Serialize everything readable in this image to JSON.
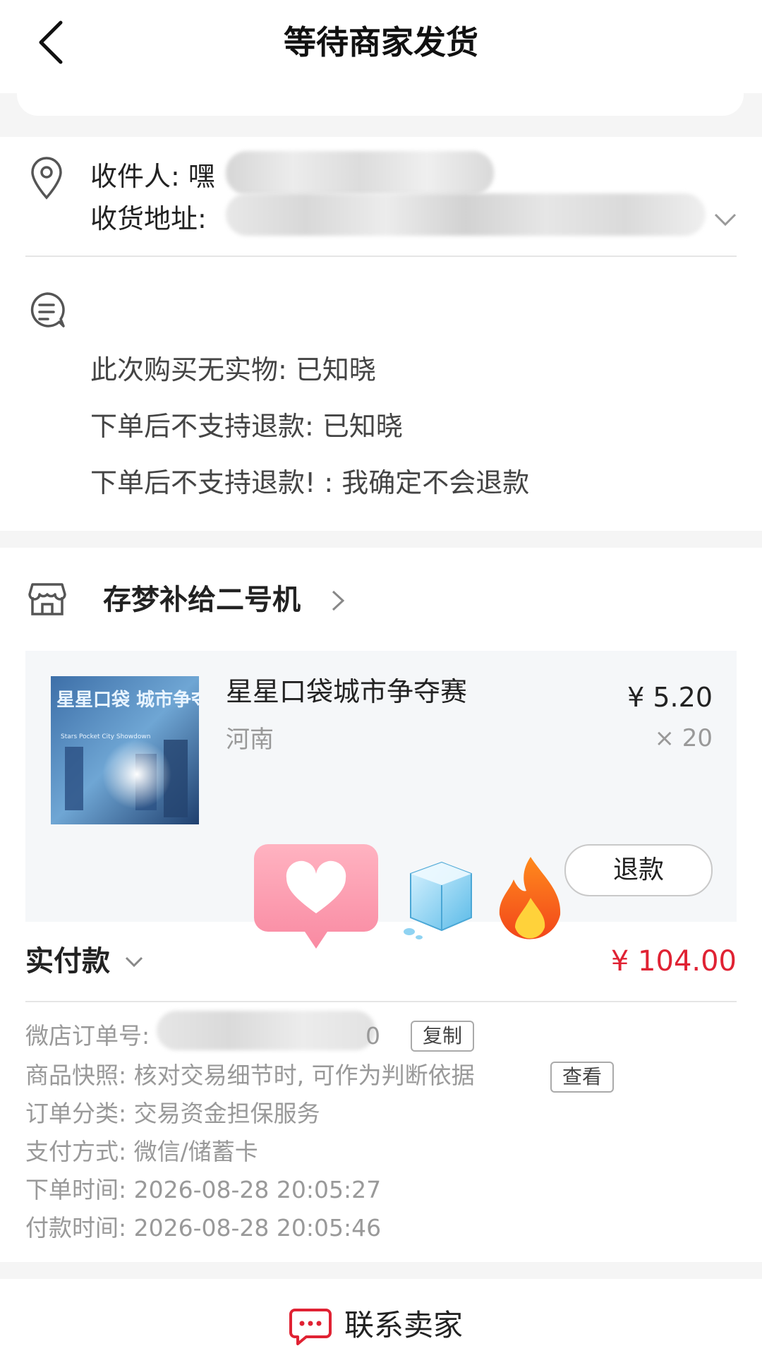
{
  "header": {
    "title": "等待商家发货"
  },
  "address": {
    "recipient_label": "收件人: 嘿",
    "address_label": "收货地址:"
  },
  "notes": [
    "此次购买无实物: 已知晓",
    "下单后不支持退款: 已知晓",
    "下单后不支持退款! : 我确定不会退款"
  ],
  "shop": {
    "name": "存梦补给二号机"
  },
  "product": {
    "name": "星星口袋城市争夺赛",
    "spec": "河南",
    "price": "¥ 5.20",
    "qty": "× 20",
    "image_title": "星星口袋 城市争夺赛",
    "image_subtitle": "Stars Pocket City Showdown",
    "refund_label": "退款"
  },
  "payment": {
    "label": "实付款",
    "amount": "¥ 104.00"
  },
  "order_info": {
    "order_no_label": "微店订单号:",
    "order_no_tail": "0",
    "copy_label": "复制",
    "snapshot": "商品快照: 核对交易细节时, 可作为判断依据",
    "view_label": "查看",
    "category": "订单分类:  交易资金担保服务",
    "pay_method": "支付方式:  微信/储蓄卡",
    "order_time": "下单时间:  2026-08-28 20:05:27",
    "pay_time": "付款时间:  2026-08-28 20:05:46"
  },
  "bottom": {
    "contact_label": "联系卖家"
  },
  "colors": {
    "accent_red": "#e02233",
    "background": "#f5f5f5"
  }
}
